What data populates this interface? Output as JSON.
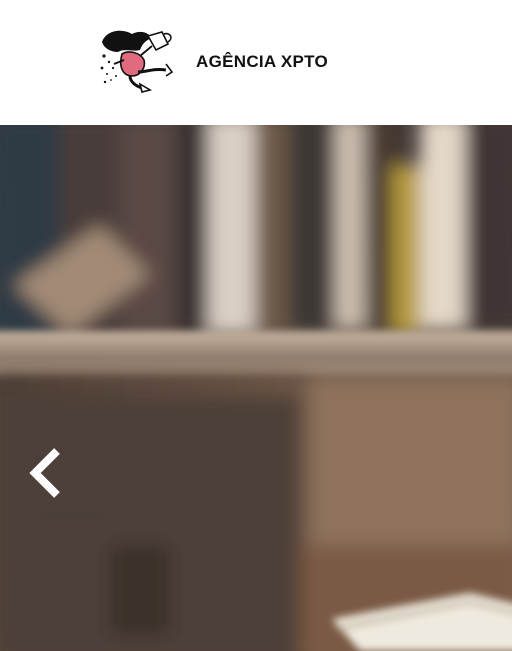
{
  "header": {
    "brand_name": "AGÊNCIA XPTO",
    "logo_icon": "coffee-cup-character-logo"
  },
  "hero": {
    "image_subject": "blurred-bookshelf-photo",
    "prev_icon": "chevron-left-icon"
  },
  "colors": {
    "header_background": "#ffffff",
    "brand_text": "#111111",
    "arrow": "#ffffff",
    "logo_accent": "#e06a7e"
  }
}
